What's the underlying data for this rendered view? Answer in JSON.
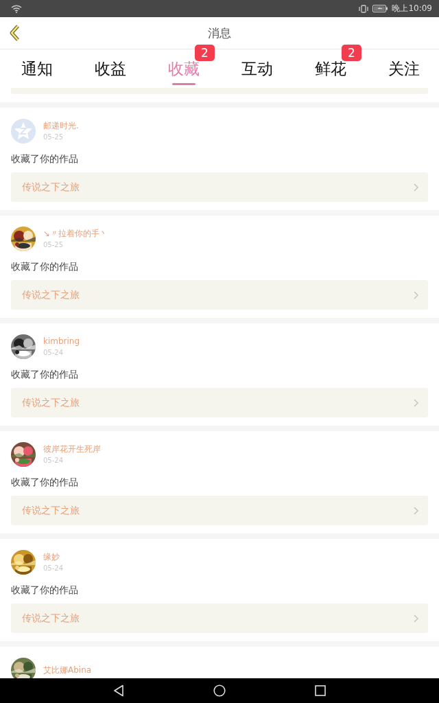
{
  "status_bar": {
    "time": "晚上10:09"
  },
  "header": {
    "title": "消息"
  },
  "tabs": [
    {
      "label": "通知",
      "selected": false
    },
    {
      "label": "收益",
      "selected": false
    },
    {
      "label": "收藏",
      "selected": true,
      "badge": "2"
    },
    {
      "label": "互动",
      "selected": false
    },
    {
      "label": "鲜花",
      "selected": false,
      "badge": "2"
    },
    {
      "label": "关注",
      "selected": false
    }
  ],
  "items": [
    {
      "avatar": {
        "kind": "default"
      },
      "name": "邮递时光.",
      "date": "05-25",
      "action": "收藏了你的作品",
      "work": "传说之下之旅"
    },
    {
      "name": "↘〃拉着你的手丶",
      "date": "05-25",
      "action": "收藏了你的作品",
      "work": "传说之下之旅"
    },
    {
      "name": "kimbring",
      "date": "05-24",
      "action": "收藏了你的作品",
      "work": "传说之下之旅"
    },
    {
      "name": "彼岸花开生死岸",
      "date": "05-24",
      "action": "收藏了你的作品",
      "work": "传说之下之旅"
    },
    {
      "name": "缘妙",
      "date": "05-24",
      "action": "收藏了你的作品",
      "work": "传说之下之旅"
    },
    {
      "name": "艾比娜Abina"
    }
  ]
}
